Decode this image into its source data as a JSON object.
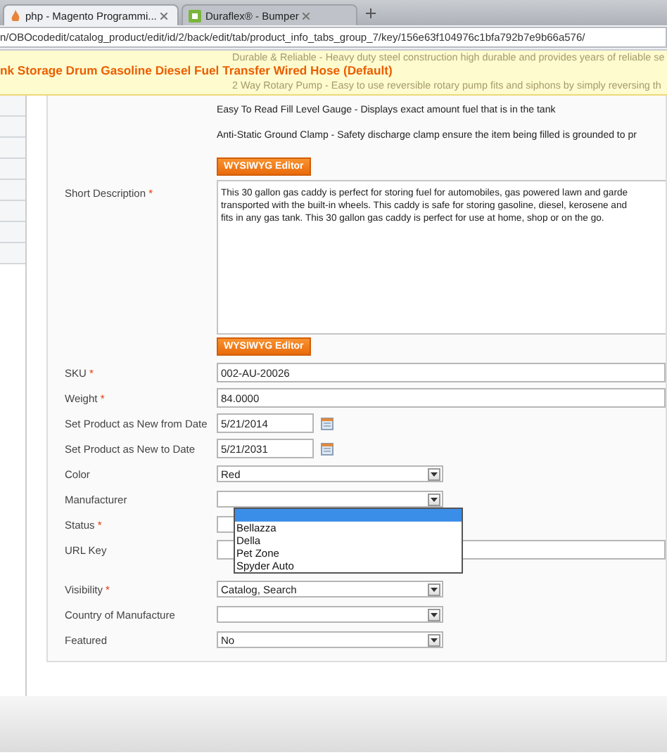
{
  "browser": {
    "tabs": [
      {
        "title": "php - Magento Programmi...",
        "selected": true
      },
      {
        "title": "Duraflex® - Bumper",
        "selected": false
      }
    ],
    "address": "n/OBOcodedit/catalog_product/edit/id/2/back/edit/tab/product_info_tabs_group_7/key/156e63f104976c1bfa792b7e9b66a576/"
  },
  "header": {
    "title": "nk Storage Drum Gasoline Diesel Fuel Transfer Wired Hose (Default)",
    "faded_lines": [
      "Durable & Reliable - Heavy duty steel construction high durable and provides years of reliable se",
      "2 Way Rotary Pump - Easy to use reversible rotary pump fits and siphons by simply reversing th"
    ]
  },
  "description": {
    "lines": [
      "Easy To Read Fill Level Gauge - Displays exact amount fuel that is in the tank",
      "Anti-Static Ground Clamp - Safety discharge clamp ensure the item being filled is grounded to pr"
    ],
    "button": "WYSIWYG Editor"
  },
  "short_description": {
    "label": "Short Description",
    "required_mark": "*",
    "lines": [
      "This 30 gallon gas caddy is perfect for storing fuel for automobiles, gas powered lawn and garde",
      "transported with the built-in wheels. This caddy is safe for storing gasoline, diesel, kerosene and",
      "fits in any gas tank. This 30 gallon gas caddy is perfect for use at home, shop or on the go."
    ],
    "button": "WYSIWYG Editor"
  },
  "fields": [
    {
      "kind": "text",
      "label": "SKU",
      "required_mark": "*",
      "value": "002-AU-20026"
    },
    {
      "kind": "text",
      "label": "Weight",
      "required_mark": "*",
      "value": "84.0000"
    },
    {
      "kind": "date",
      "label": "Set Product as New from Date",
      "value": "5/21/2014"
    },
    {
      "kind": "date",
      "label": "Set Product as New to Date",
      "value": "5/21/2031"
    },
    {
      "kind": "select",
      "label": "Color",
      "value": "Red"
    },
    {
      "kind": "dropdown",
      "label": "Manufacturer",
      "options": [
        {
          "selected": true
        },
        {
          "label": "Bellazza",
          "selected": false
        },
        {
          "label": "Della",
          "selected": false
        },
        {
          "label": "Pet Zone",
          "selected": false
        },
        {
          "label": "Spyder Auto",
          "selected": false
        }
      ]
    },
    {
      "kind": "select",
      "label": "Status",
      "required_mark": "*"
    },
    {
      "kind": "text",
      "label": "URL Key"
    },
    {
      "kind": "spacer"
    },
    {
      "kind": "select",
      "label": "Visibility",
      "required_mark": "*",
      "value": "Catalog, Search"
    },
    {
      "kind": "select",
      "label": "Country of Manufacture"
    },
    {
      "kind": "select",
      "label": "Featured",
      "value": "No"
    }
  ]
}
